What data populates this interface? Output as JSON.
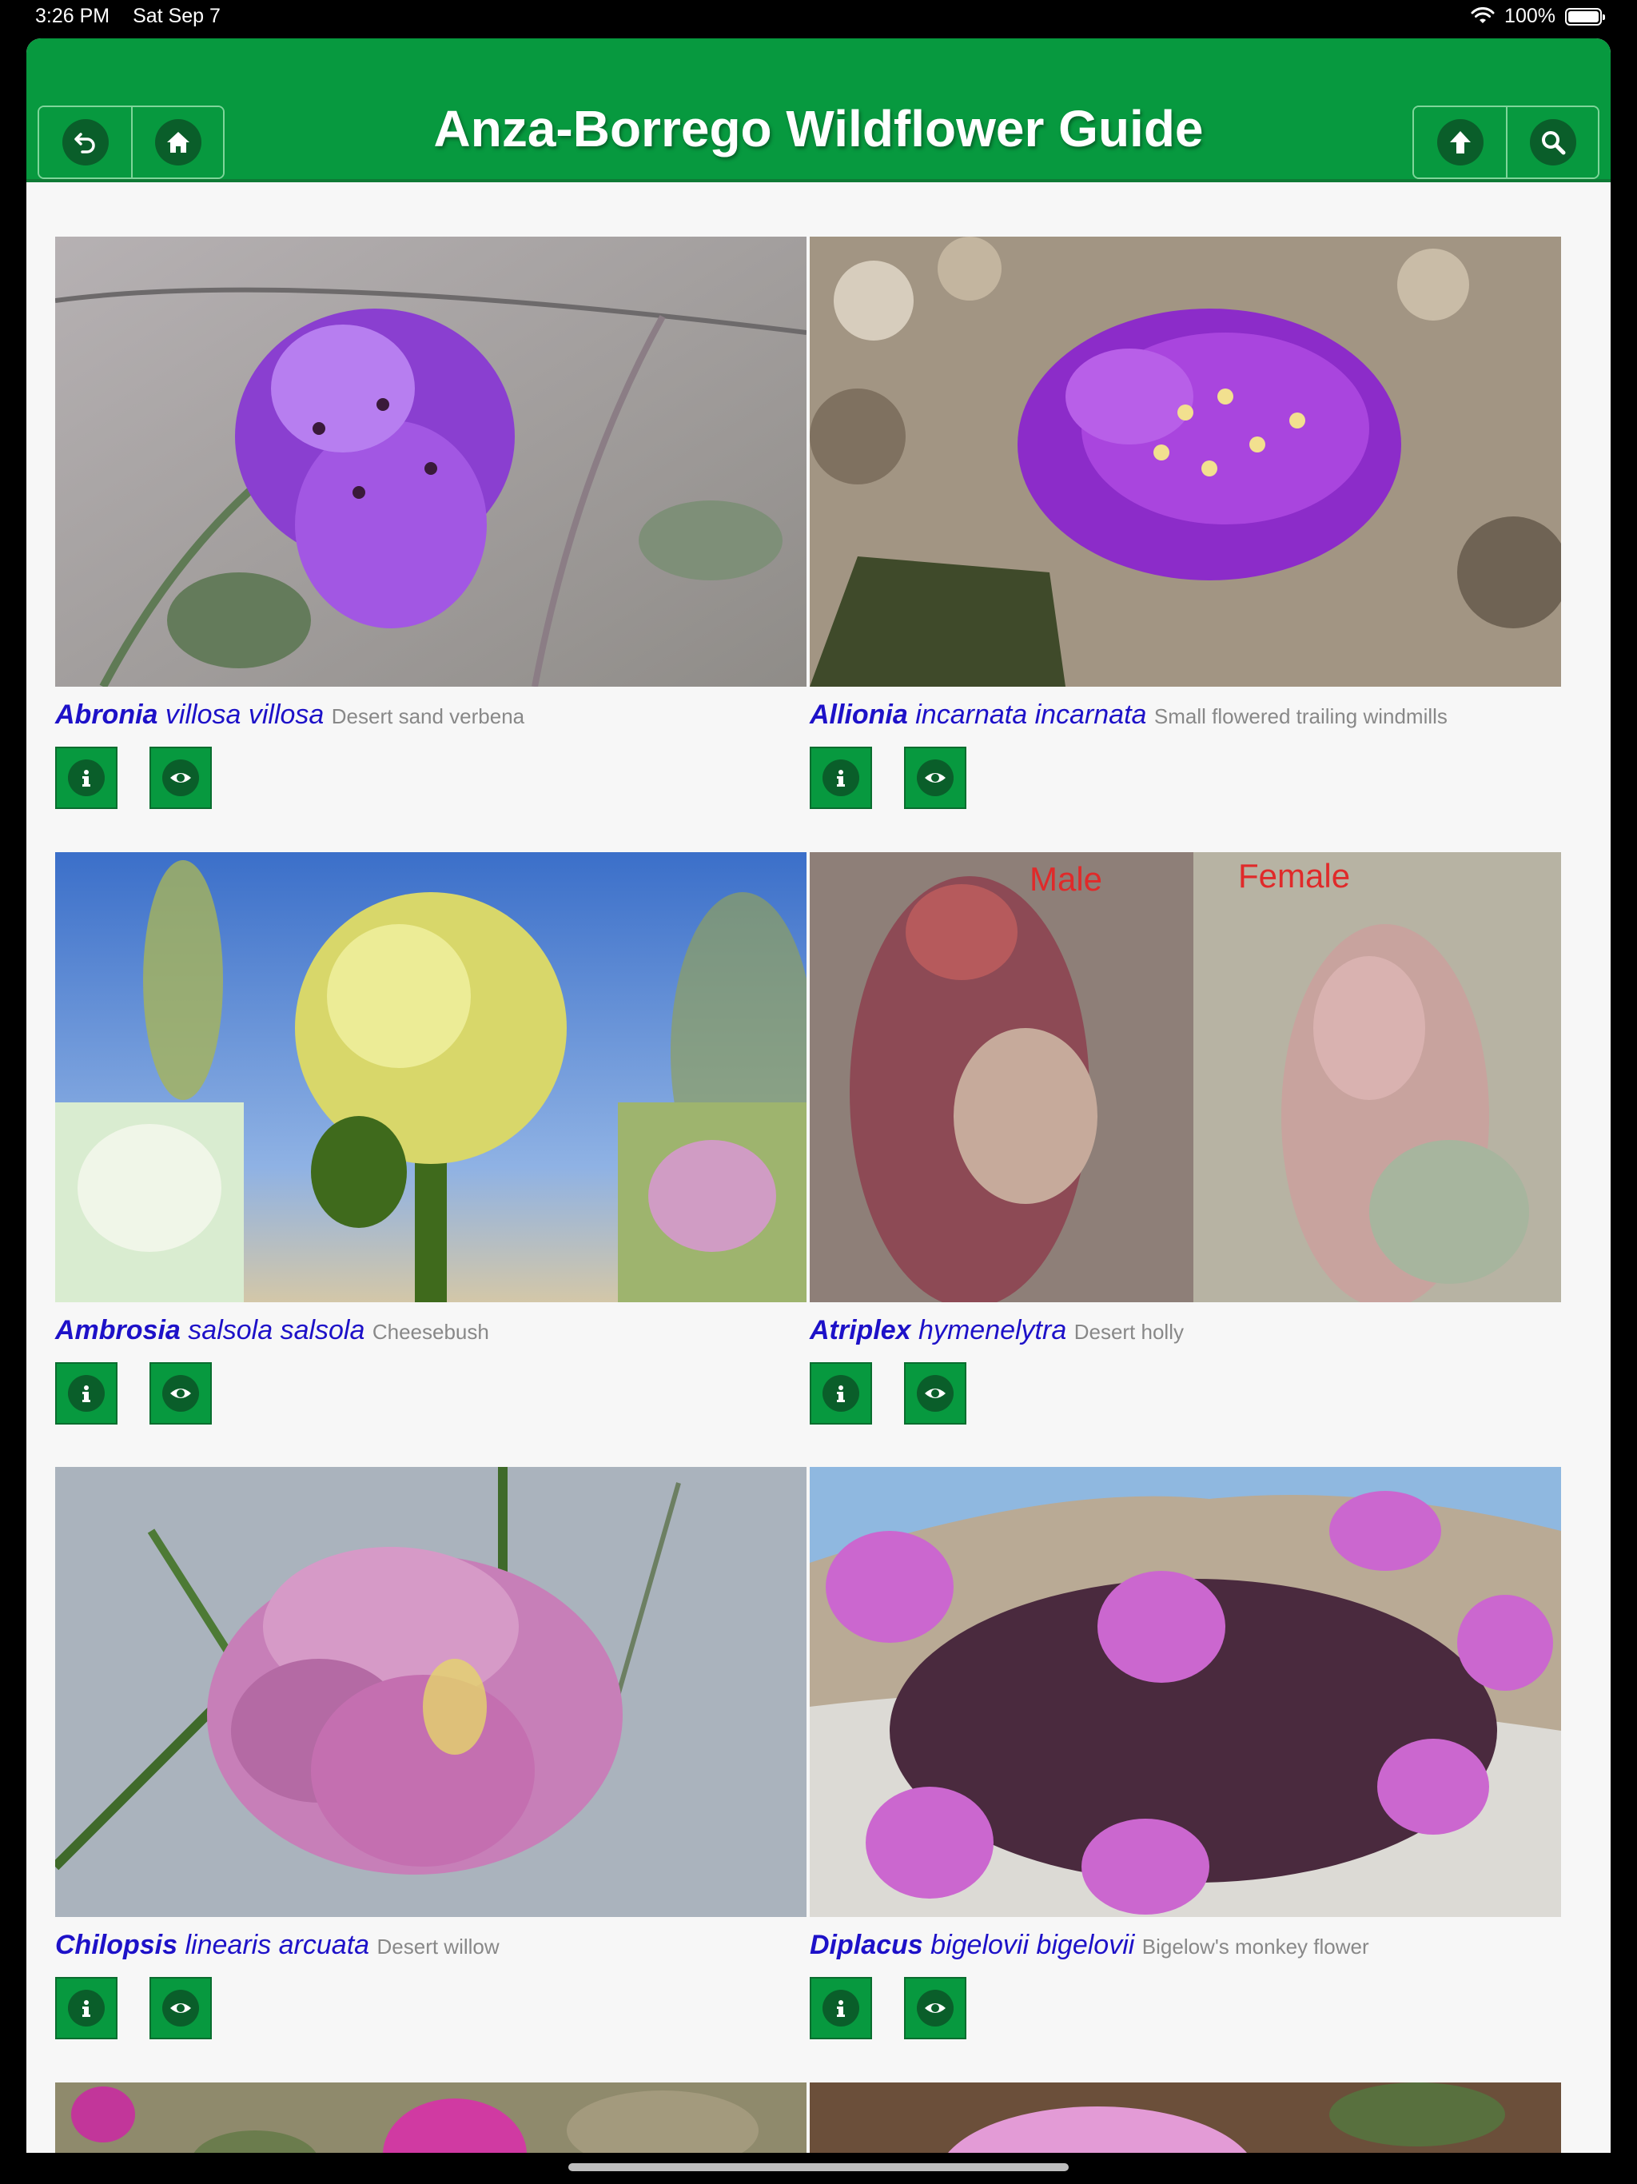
{
  "status_bar": {
    "time": "3:26 PM",
    "date": "Sat Sep 7",
    "battery": "100%",
    "icons": [
      "wifi-icon",
      "battery-icon"
    ]
  },
  "header": {
    "title": "Anza-Borrego Wildflower Guide",
    "left_buttons": [
      "back-icon",
      "home-icon"
    ],
    "right_buttons": [
      "up-arrow-icon",
      "search-icon"
    ]
  },
  "colors": {
    "header_green": "#07993f",
    "name_blue": "#1d11c8",
    "common_gray": "#888888"
  },
  "species": [
    {
      "genus": "Abronia",
      "epithet": "villosa villosa",
      "common": "Desert sand verbena"
    },
    {
      "genus": "Allionia",
      "epithet": "incarnata incarnata",
      "common": "Small flowered trailing windmills"
    },
    {
      "genus": "Ambrosia",
      "epithet": "salsola salsola",
      "common": "Cheesebush"
    },
    {
      "genus": "Atriplex",
      "epithet": "hymenelytra",
      "common": "Desert holly",
      "photo_labels": [
        "Male",
        "Female"
      ]
    },
    {
      "genus": "Chilopsis",
      "epithet": "linearis arcuata",
      "common": "Desert willow"
    },
    {
      "genus": "Diplacus",
      "epithet": "bigelovii bigelovii",
      "common": "Bigelow's monkey flower"
    }
  ],
  "card_actions": [
    "info-icon",
    "eye-icon"
  ]
}
